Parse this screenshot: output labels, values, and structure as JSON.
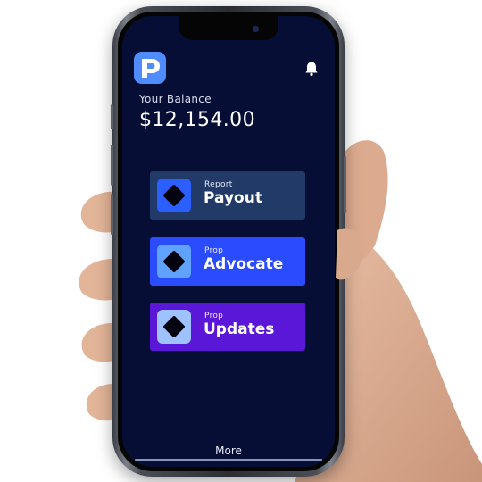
{
  "app": {
    "logo_letter": "P",
    "balance_label": "Your Balance",
    "balance_value": "$12,154.00",
    "notification_icon": "bell-icon"
  },
  "cards": [
    {
      "subtitle": "Report",
      "title": "Payout",
      "color": "#213a68",
      "icon_color": "#2b5fff"
    },
    {
      "subtitle": "Prop",
      "title": "Advocate",
      "color": "#2b4bff",
      "icon_color": "#5fa2ff"
    },
    {
      "subtitle": "Prop",
      "title": "Updates",
      "color": "#5a17d8",
      "icon_color": "#9ec2ff"
    }
  ],
  "footer": {
    "more_label": "More"
  },
  "colors": {
    "screen_bg": "#060e35",
    "accent": "#4f8dff"
  }
}
